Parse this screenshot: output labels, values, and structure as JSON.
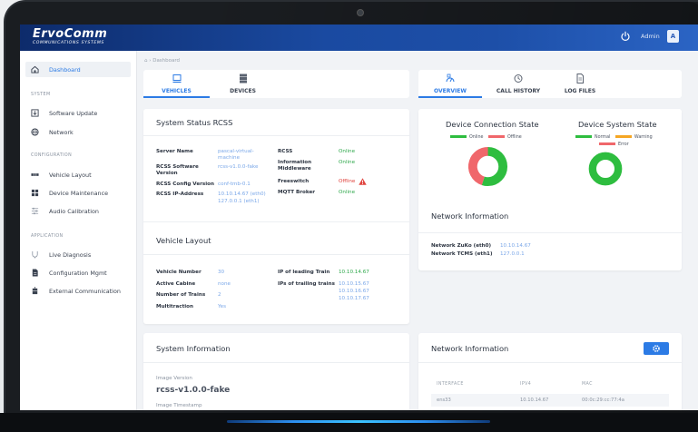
{
  "app": {
    "logo_main": "ErvoComm",
    "logo_sub": "COMMUNICATIONS SYSTEMS",
    "user_label": "Admin",
    "avatar_initial": "A"
  },
  "sidebar": {
    "dashboard": "Dashboard",
    "section_system": "SYSTEM",
    "software_update": "Software Update",
    "network": "Network",
    "section_configuration": "CONFIGURATION",
    "vehicle_layout": "Vehicle Layout",
    "device_maintenance": "Device Maintenance",
    "audio_calibration": "Audio Calibration",
    "section_application": "APPLICATION",
    "live_diagnosis": "Live Diagnosis",
    "configuration_mgmt": "Configuration Mgmt",
    "external_communication": "External Communication"
  },
  "breadcrumb": "Dashboard",
  "left_tabs": [
    "VEHICLES",
    "DEVICES"
  ],
  "right_tabs": [
    "OVERVIEW",
    "CALL HISTORY",
    "LOG FILES"
  ],
  "system_status": {
    "title": "System Status RCSS",
    "server_name_label": "Server Name",
    "server_name_value": "pascal-virtual-machine",
    "rcss_sw_label": "RCSS Software Version",
    "rcss_sw_value": "rcss-v1.0.0-fake",
    "rcss_cfg_label": "RCSS Config Version",
    "rcss_cfg_value": "conf-tmb-0.1",
    "rcss_ip_label": "RCSS IP-Address",
    "rcss_ip_value1": "10.10.14.67 (eth0)",
    "rcss_ip_value2": "127.0.0.1 (eth1)",
    "rcss_label": "RCSS",
    "rcss_status": "Online",
    "info_mw_label": "Information Middleware",
    "info_mw_status": "Online",
    "freeswitch_label": "Freeswitch",
    "freeswitch_status": "Offline",
    "mqtt_label": "MQTT Broker",
    "mqtt_status": "Online"
  },
  "vehicle_layout": {
    "title": "Vehicle Layout",
    "vehicle_number_label": "Vehicle Number",
    "vehicle_number_value": "30",
    "active_cabine_label": "Active Cabine",
    "active_cabine_value": "none",
    "number_of_trains_label": "Number of Trains",
    "number_of_trains_value": "2",
    "multitraction_label": "Multitraction",
    "multitraction_value": "Yes",
    "ip_leading_label": "IP of leading Train",
    "ip_leading_value": "10.10.14.67",
    "ips_trailing_label": "IPs of trailing trains",
    "ips_trailing_values": [
      "10.10.15.67",
      "10.10.16.67",
      "10.10.17.67"
    ]
  },
  "system_information": {
    "title": "System Information",
    "image_version_label": "Image Version",
    "image_version_value": "rcss-v1.0.0-fake",
    "image_timestamp_label": "Image Timestamp"
  },
  "device_connection": {
    "title": "Device Connection State",
    "legend_online": "Online",
    "legend_offline": "Offline",
    "online_fraction": 0.55,
    "offline_fraction": 0.45,
    "online_color": "#2ebd3f",
    "offline_color": "#f0676b"
  },
  "device_system": {
    "title": "Device System State",
    "legend_normal": "Normal",
    "legend_warning": "Warning",
    "legend_error": "Error",
    "normal_fraction": 1.0,
    "normal_color": "#2ebd3f",
    "warning_color": "#f5a623",
    "error_color": "#f0676b"
  },
  "network_information": {
    "title": "Network Information",
    "zuko_label": "Network ZuKo (eth0)",
    "zuko_value": "10.10.14.67",
    "tcms_label": "Network TCMS (eth1)",
    "tcms_value": "127.0.0.1"
  },
  "network_table": {
    "title": "Network Information",
    "columns": [
      "INTERFACE",
      "IPV4",
      "MAC"
    ],
    "rows": [
      {
        "interface": "ens33",
        "ipv4": "10.10.14.67",
        "mac": "00:0c:29:cc:77:4a"
      }
    ]
  },
  "colors": {
    "accent": "#2c7be5",
    "online": "#2ea84b",
    "offline": "#e0443e",
    "link_value": "#7aa7e8"
  }
}
